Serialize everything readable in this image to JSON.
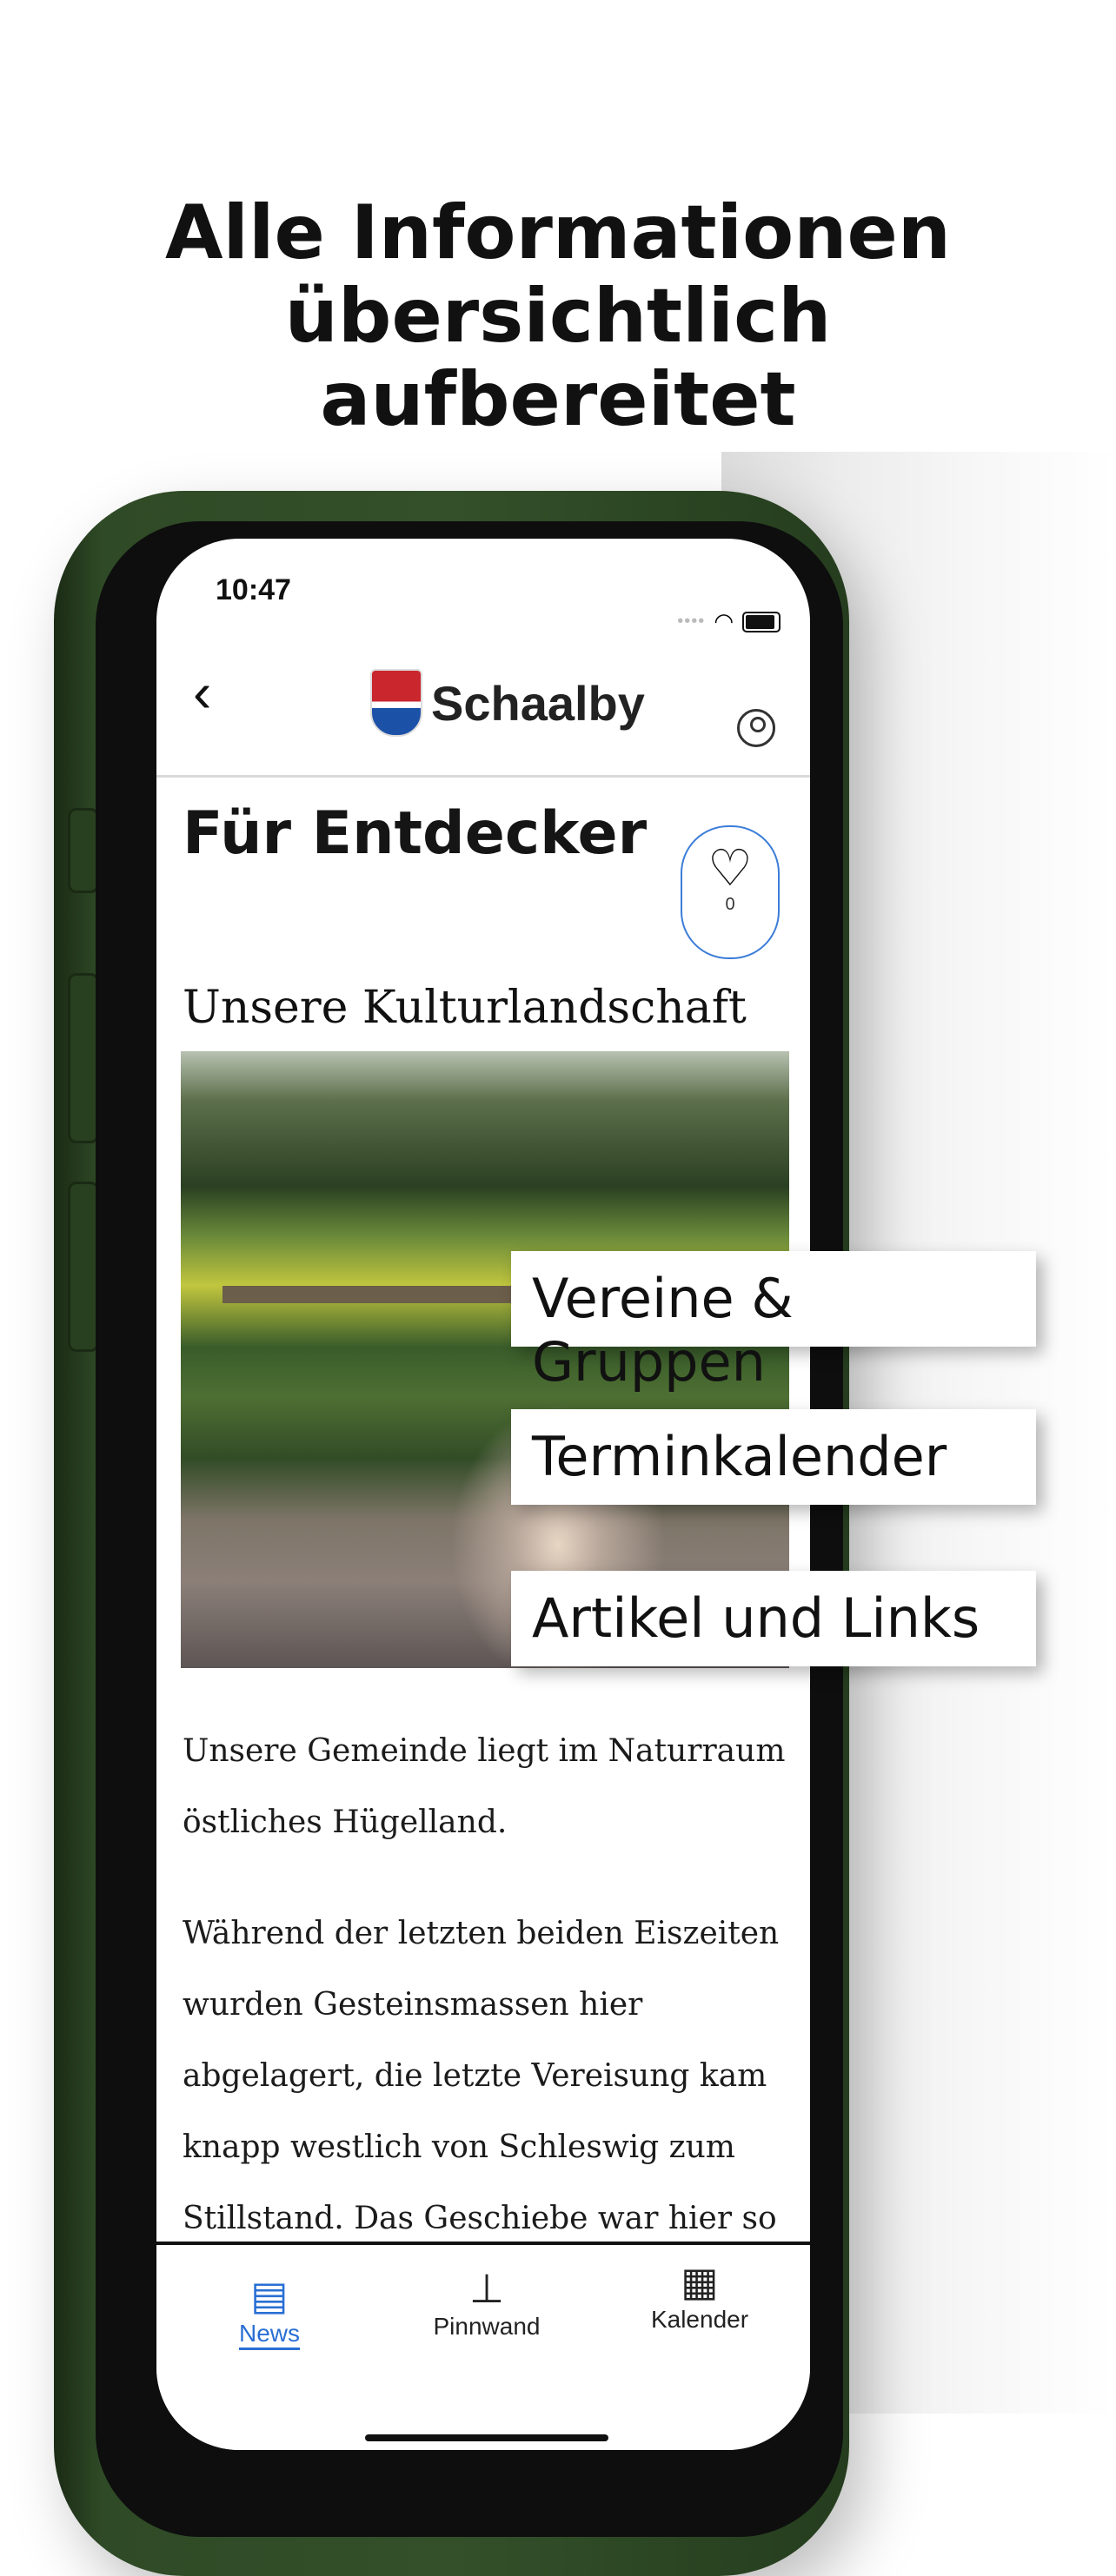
{
  "headline": {
    "line1": "Alle Informationen",
    "line2": "übersichtlich",
    "line3": "aufbereitet"
  },
  "status_bar": {
    "time": "10:47"
  },
  "header": {
    "logo_text": "Schaalby"
  },
  "article": {
    "title": "Für Entdecker",
    "favorite_count": "0",
    "subtitle": "Unsere Kulturlandschaft",
    "paragraph1": "Unsere Gemeinde liegt im Naturraum östliches Hügelland.",
    "paragraph2": "Während der letzten beiden Eiszeiten wurden Gesteinsmassen hier abgelagert, die letzte Vereisung kam knapp westlich von Schleswig zum Stillstand. Das Geschiebe war hier so hochaufgetürmt, dass das Schmelzwasser unter dem Gletscher in Richtung"
  },
  "tabs": [
    {
      "label": "News",
      "icon": "newspaper-icon",
      "active": true
    },
    {
      "label": "Pinnwand",
      "icon": "pin-icon",
      "active": false
    },
    {
      "label": "Kalender",
      "icon": "calendar-icon",
      "active": false
    }
  ],
  "features": [
    "Vereine & Gruppen",
    "Terminkalender",
    "Artikel und Links"
  ],
  "colors": {
    "accent": "#2a6fd4",
    "phone_frame": "#33502a"
  }
}
